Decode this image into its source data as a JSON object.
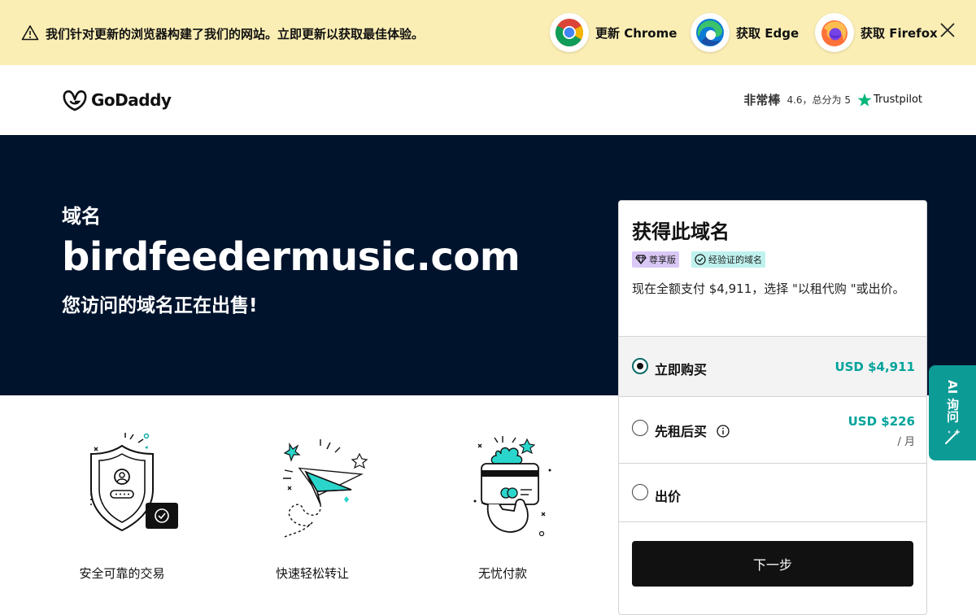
{
  "banner": {
    "message": "我们针对更新的浏览器构建了我们的网站。立即更新以获取最佳体验。",
    "buttons": [
      {
        "label": "更新 Chrome",
        "icon": "chrome-icon"
      },
      {
        "label": "获取 Edge",
        "icon": "edge-icon"
      },
      {
        "label": "获取 Firefox",
        "icon": "firefox-icon"
      }
    ],
    "bg_color": "#fbeeb4"
  },
  "header": {
    "logo_text": "GoDaddy",
    "rating_word": "非常棒",
    "rating_detail": "4.6，总分为 5",
    "rating_brand": "Trustpilot"
  },
  "hero": {
    "label": "域名",
    "domain": "birdfeedermusic.com",
    "subtitle": "您访问的域名正在出售!",
    "bg_color": "#00132d"
  },
  "features": [
    {
      "caption": "安全可靠的交易",
      "icon": "secure-shield-icon"
    },
    {
      "caption": "快速轻松转让",
      "icon": "paper-plane-icon"
    },
    {
      "caption": "无忧付款",
      "icon": "payment-card-icon"
    }
  ],
  "purchase": {
    "title": "获得此域名",
    "badges": [
      "尊享版",
      "经验证的域名"
    ],
    "description": "现在全额支付 $4,911，选择 \"以租代购 \"或出价。",
    "options": [
      {
        "label": "立即购买",
        "price": "USD $4,911",
        "per": "",
        "selected": true
      },
      {
        "label": "先租后买",
        "price": "USD $226",
        "per": "/ 月",
        "selected": false
      },
      {
        "label": "出价",
        "price": "",
        "per": "",
        "selected": false
      }
    ],
    "next_label": "下一步",
    "accent_color": "#00a39b"
  },
  "ai_tab": {
    "label": "AI 询问"
  }
}
